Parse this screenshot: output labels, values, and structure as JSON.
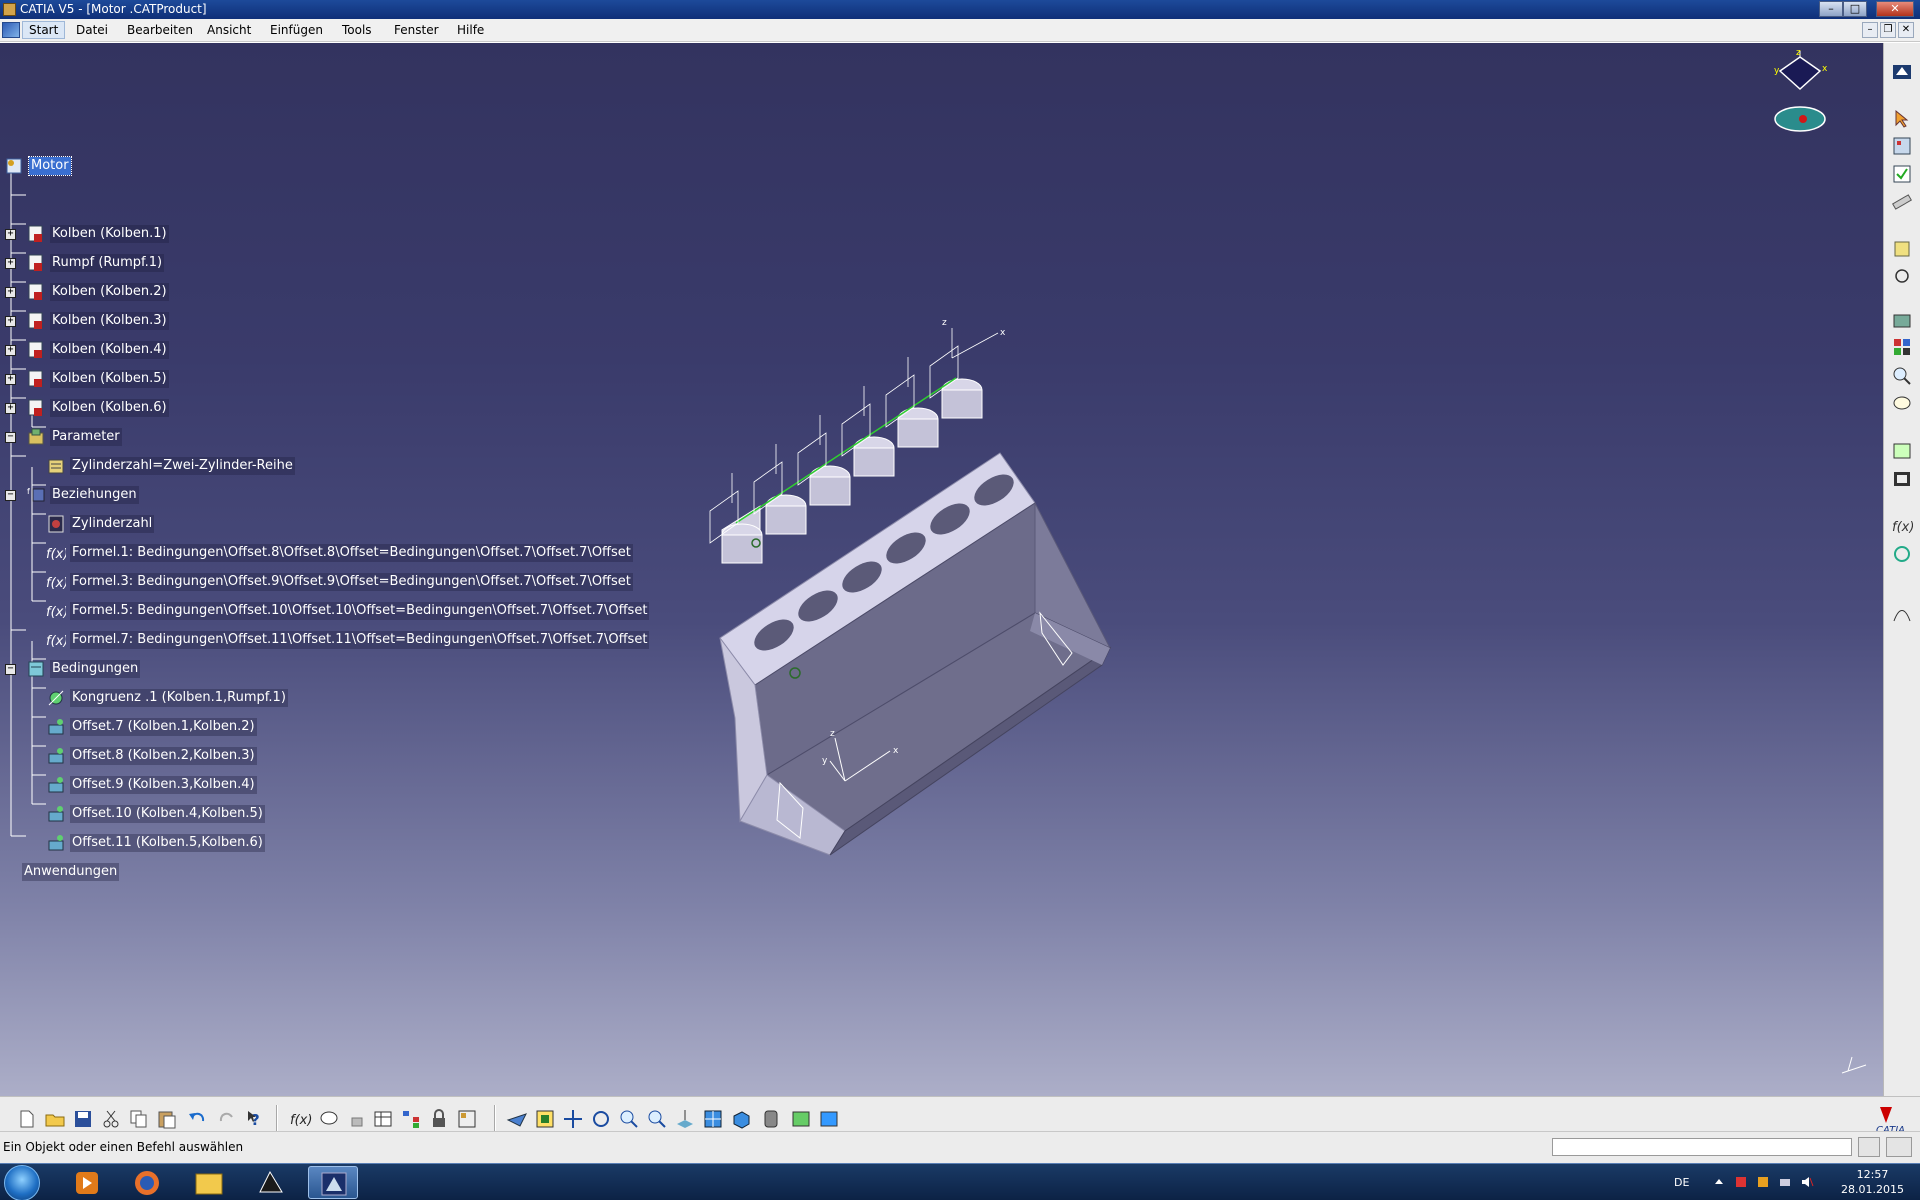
{
  "window": {
    "title": "CATIA V5 - [Motor .CATProduct]",
    "controls": {
      "minimize": "–",
      "maximize": "□",
      "close": "✕"
    }
  },
  "menubar": {
    "items": [
      "Start",
      "Datei",
      "Bearbeiten",
      "Ansicht",
      "Einfügen",
      "Tools",
      "Fenster",
      "Hilfe"
    ],
    "doc_controls": {
      "minimize": "–",
      "restore": "❐",
      "close": "✕"
    }
  },
  "tree": {
    "root": "Motor",
    "nodes": [
      {
        "label": "Kolben (Kolben.1)",
        "icon": "part-icon"
      },
      {
        "label": "Rumpf (Rumpf.1)",
        "icon": "part-icon"
      },
      {
        "label": "Kolben (Kolben.2)",
        "icon": "part-icon"
      },
      {
        "label": "Kolben (Kolben.3)",
        "icon": "part-icon"
      },
      {
        "label": "Kolben (Kolben.4)",
        "icon": "part-icon"
      },
      {
        "label": "Kolben (Kolben.5)",
        "icon": "part-icon"
      },
      {
        "label": "Kolben (Kolben.6)",
        "icon": "part-icon"
      },
      {
        "label": "Parameter",
        "icon": "parameter-icon"
      },
      {
        "label": "Zylinderzahl=Zwei-Zylinder-Reihe",
        "icon": "parameter-item-icon"
      },
      {
        "label": "Beziehungen",
        "icon": "relations-icon"
      },
      {
        "label": "Zylinderzahl",
        "icon": "rule-icon"
      },
      {
        "label": "Formel.1: Bedingungen\\Offset.8\\Offset.8\\Offset=Bedingungen\\Offset.7\\Offset.7\\Offset",
        "icon": "formula-icon"
      },
      {
        "label": "Formel.3: Bedingungen\\Offset.9\\Offset.9\\Offset=Bedingungen\\Offset.7\\Offset.7\\Offset",
        "icon": "formula-icon"
      },
      {
        "label": "Formel.5: Bedingungen\\Offset.10\\Offset.10\\Offset=Bedingungen\\Offset.7\\Offset.7\\Offset",
        "icon": "formula-icon"
      },
      {
        "label": "Formel.7: Bedingungen\\Offset.11\\Offset.11\\Offset=Bedingungen\\Offset.7\\Offset.7\\Offset",
        "icon": "formula-icon"
      },
      {
        "label": "Bedingungen",
        "icon": "constraints-icon"
      },
      {
        "label": "Kongruenz .1 (Kolben.1,Rumpf.1)",
        "icon": "coincidence-constraint-icon"
      },
      {
        "label": "Offset.7 (Kolben.1,Kolben.2)",
        "icon": "offset-constraint-icon"
      },
      {
        "label": "Offset.8 (Kolben.2,Kolben.3)",
        "icon": "offset-constraint-icon"
      },
      {
        "label": "Offset.9 (Kolben.3,Kolben.4)",
        "icon": "offset-constraint-icon"
      },
      {
        "label": "Offset.10 (Kolben.4,Kolben.5)",
        "icon": "offset-constraint-icon"
      },
      {
        "label": "Offset.11 (Kolben.5,Kolben.6)",
        "icon": "offset-constraint-icon"
      },
      {
        "label": "Anwendungen",
        "icon": ""
      }
    ]
  },
  "model": {
    "axis_x": "x",
    "axis_y": "y",
    "axis_z": "z",
    "piston_count": 6,
    "bore_count": 6
  },
  "compass": {
    "x": "x",
    "y": "y",
    "z": "z"
  },
  "right_toolbar": {
    "icons": [
      "sketcher-workbench-icon",
      "select-arrow-icon",
      "catalog-icon",
      "update-icon",
      "measure-icon",
      "annotation-icon",
      "rotate-icon",
      "snapshot-icon",
      "scene-icon",
      "zoom-icon",
      "comment-icon",
      "fly-icon",
      "visualization-icon",
      "formula-tool-icon",
      "law-icon",
      "knowledge-icon"
    ]
  },
  "bottom_toolbar": {
    "icons": [
      "new-file-icon",
      "open-folder-icon",
      "save-icon",
      "cut-icon",
      "copy-icon",
      "paste-icon",
      "undo-icon",
      "redo-icon",
      "help-icon",
      "formula-fx-icon",
      "comment-bubble-icon",
      "lock-icon",
      "table-icon",
      "tree-icon",
      "padlock-icon",
      "design-table-icon",
      "fly-mode-icon",
      "fit-all-icon",
      "pan-icon",
      "rotate-view-icon",
      "zoom-in-icon",
      "zoom-out-icon",
      "normal-view-icon",
      "multi-view-icon",
      "iso-view-icon",
      "shading-icon",
      "hide-show-icon",
      "swap-visible-icon"
    ],
    "brand": "CATIA"
  },
  "status": {
    "message": "Ein Objekt oder einen Befehl auswählen",
    "command_value": ""
  },
  "taskbar": {
    "apps": [
      "media-player-icon",
      "firefox-icon",
      "explorer-icon",
      "catia-v5-icon",
      "catia-active-icon"
    ],
    "language": "DE",
    "time": "12:57",
    "date": "28.01.2015"
  }
}
